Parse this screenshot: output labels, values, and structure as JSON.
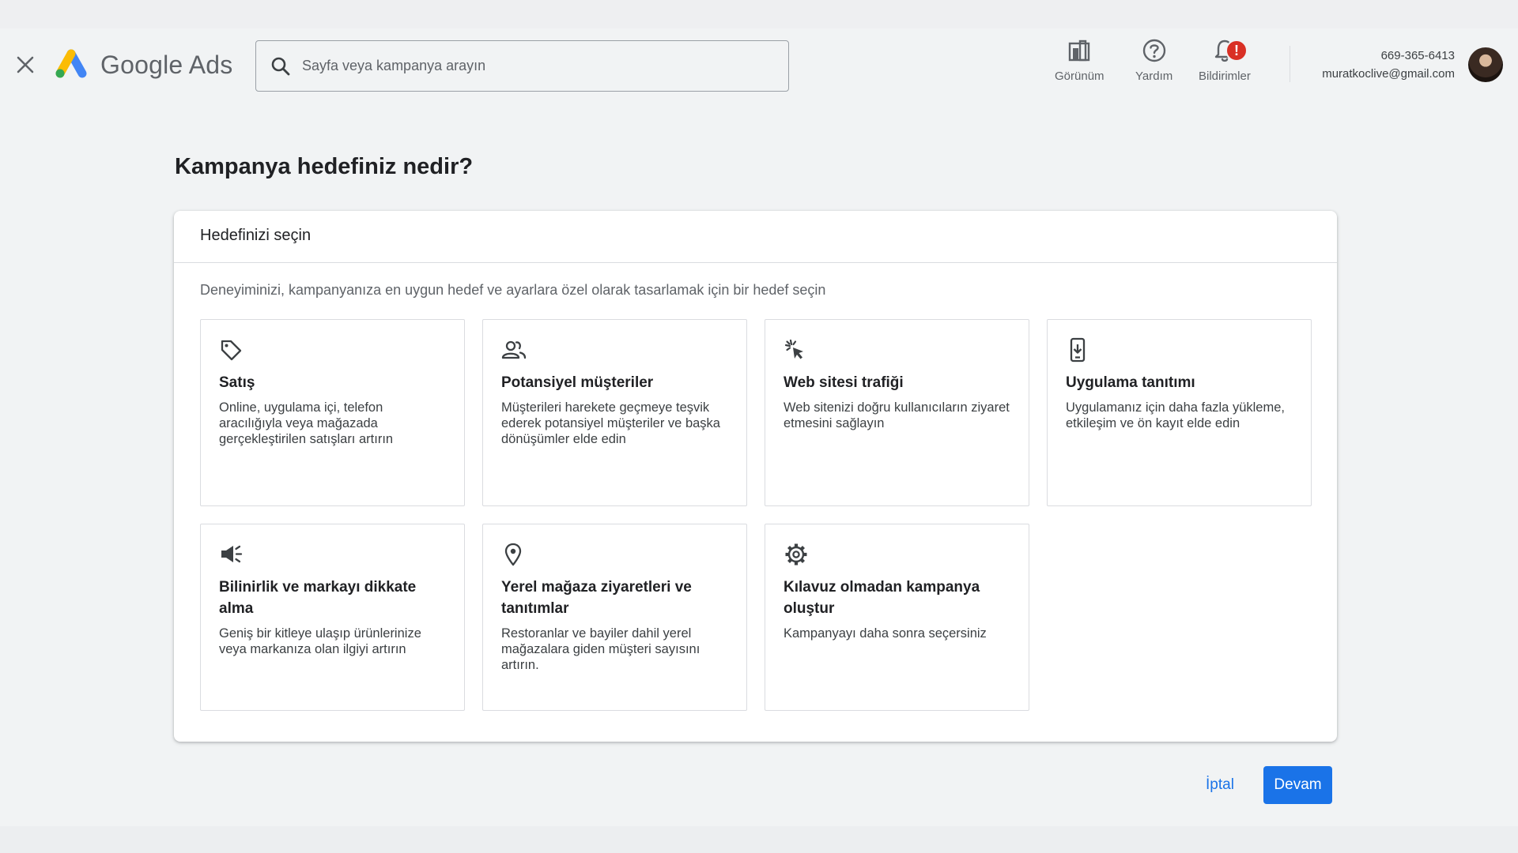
{
  "header": {
    "brand": "Google Ads",
    "search_placeholder": "Sayfa veya kampanya arayın",
    "actions": [
      {
        "label": "Görünüm",
        "icon": "appearance-icon"
      },
      {
        "label": "Yardım",
        "icon": "help-icon"
      },
      {
        "label": "Bildirimler",
        "icon": "bell-icon",
        "badge": "!"
      }
    ],
    "account": {
      "phone": "669-365-6413",
      "email": "muratkoclive@gmail.com"
    }
  },
  "page": {
    "title": "Kampanya hedefiniz nedir?"
  },
  "card": {
    "heading": "Hedefinizi seçin",
    "description": "Deneyiminizi, kampanyanıza en uygun hedef ve ayarlara özel olarak tasarlamak için bir hedef seçin",
    "options": [
      {
        "title": "Satış",
        "text": "Online, uygulama içi, telefon aracılığıyla veya mağazada gerçekleştirilen satışları artırın",
        "icon": "tag-icon"
      },
      {
        "title": "Potansiyel müşteriler",
        "text": "Müşterileri harekete geçmeye teşvik ederek potansiyel müşteriler ve başka dönüşümler elde edin",
        "icon": "people-icon"
      },
      {
        "title": "Web sitesi trafiği",
        "text": "Web sitenizi doğru kullanıcıların ziyaret etmesini sağlayın",
        "icon": "cursor-click-icon"
      },
      {
        "title": "Uygulama tanıtımı",
        "text": "Uygulamanız için daha fazla yükleme, etkileşim ve ön kayıt elde edin",
        "icon": "phone-download-icon"
      },
      {
        "title": "Bilinirlik ve markayı dikkate alma",
        "text": "Geniş bir kitleye ulaşıp ürünlerinize veya markanıza olan ilgiyi artırın",
        "icon": "megaphone-icon"
      },
      {
        "title": "Yerel mağaza ziyaretleri ve tanıtımlar",
        "text": "Restoranlar ve bayiler dahil yerel mağazalara giden müşteri sayısını artırın.",
        "icon": "location-pin-icon"
      },
      {
        "title": "Kılavuz olmadan kampanya oluştur",
        "text": "Kampanyayı daha sonra seçersiniz",
        "icon": "gear-icon"
      }
    ]
  },
  "footer": {
    "cancel_label": "İptal",
    "continue_label": "Devam"
  },
  "colors": {
    "accent": "#1a73e8",
    "badge": "#d93025",
    "background": "#f1f3f4"
  }
}
